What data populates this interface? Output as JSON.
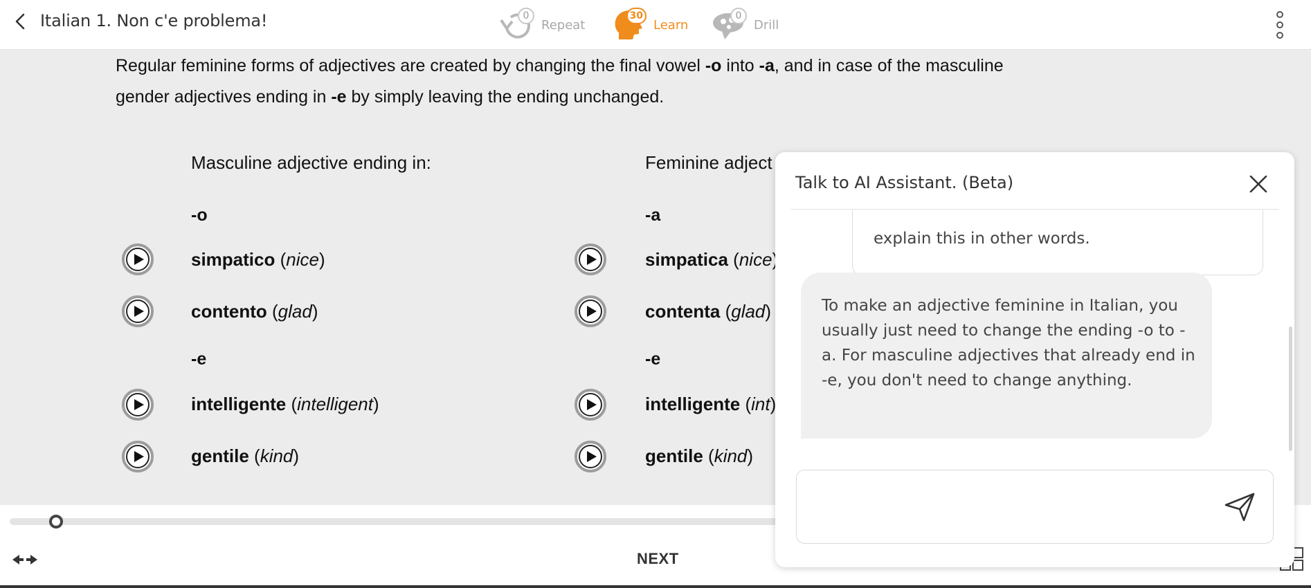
{
  "header": {
    "course_title": "Italian 1. Non c'e problema!",
    "modes": [
      {
        "label": "Repeat",
        "count": "0",
        "icon": "repeat-icon"
      },
      {
        "label": "Learn",
        "count": "30",
        "icon": "head-icon"
      },
      {
        "label": "Drill",
        "count": "0",
        "icon": "brain-icon"
      }
    ],
    "active_mode": "Learn",
    "accent_color": "#f08c1c"
  },
  "lesson": {
    "intro": {
      "part1": "Regular feminine forms of adjectives are created by changing the final vowel ",
      "bold1": "-o",
      "part2": " into ",
      "bold2": "-a",
      "part3": ", and in case of the masculine gender adjectives ending in ",
      "bold3": "-e",
      "part4": " by simply leaving the ending unchanged."
    },
    "masculine_header": "Masculine adjective ending in:",
    "feminine_header": "Feminine adject",
    "groups": [
      {
        "masc_suffix": "-o",
        "fem_suffix": "-a",
        "rows": [
          {
            "masc_word": "simpatico",
            "masc_gloss": "nice",
            "fem_word": "simpatica",
            "fem_gloss": "nice"
          },
          {
            "masc_word": "contento",
            "masc_gloss": "glad",
            "fem_word": "contenta",
            "fem_gloss": "glad"
          }
        ]
      },
      {
        "masc_suffix": "-e",
        "fem_suffix": "-e",
        "rows": [
          {
            "masc_word": "intelligente",
            "masc_gloss": "intelligent",
            "fem_word": "intelligente",
            "fem_gloss": "int"
          },
          {
            "masc_word": "gentile",
            "masc_gloss": "kind",
            "fem_word": "gentile",
            "fem_gloss": "kind"
          }
        ]
      }
    ],
    "progress_fraction": 0.05
  },
  "footer": {
    "next_label": "NEXT"
  },
  "assistant": {
    "title": "Talk to AI Assistant. (Beta)",
    "user_message_visible": "explain this in other words.",
    "bot_message": "To make an adjective feminine in Italian, you usually just need to change the ending -o to -a. For masculine adjectives that already end in -e, you don't need to change anything.",
    "input_value": "",
    "input_placeholder": ""
  }
}
